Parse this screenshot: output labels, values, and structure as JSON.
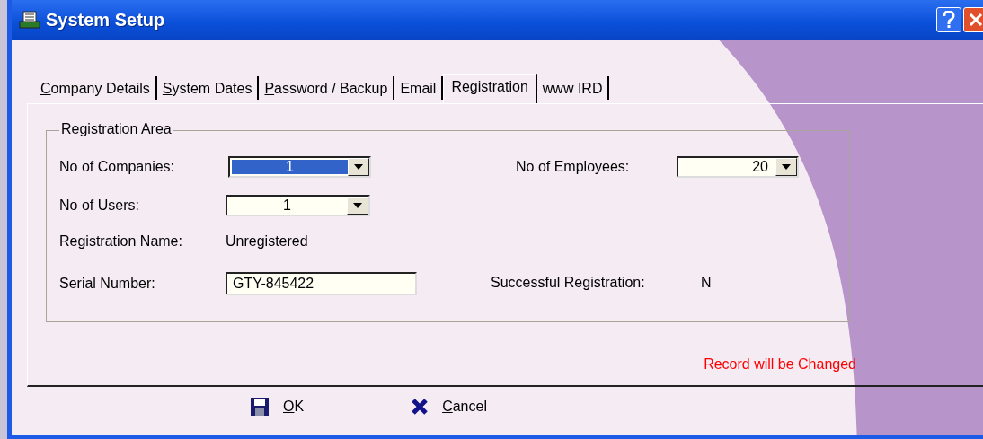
{
  "window": {
    "title": "System Setup"
  },
  "tabs": [
    {
      "label": "Company Details",
      "selected": false,
      "mnemonic": true
    },
    {
      "label": "System Dates",
      "selected": false,
      "mnemonic": true
    },
    {
      "label": "Password / Backup",
      "selected": false,
      "mnemonic": true
    },
    {
      "label": "Email",
      "selected": false,
      "mnemonic": false
    },
    {
      "label": "Registration",
      "selected": true,
      "mnemonic": false
    },
    {
      "label": "www IRD",
      "selected": false,
      "mnemonic": false
    }
  ],
  "group": {
    "title": "Registration Area",
    "companies": {
      "label": "No of Companies:",
      "value": "1",
      "selected": true
    },
    "users": {
      "label": "No of Users:",
      "value": "1",
      "selected": false
    },
    "employees": {
      "label": "No of Employees:",
      "value": "20",
      "selected": false
    },
    "registration_name": {
      "label": "Registration Name:",
      "value": "Unregistered"
    },
    "serial": {
      "label": "Serial Number:",
      "value": "GTY-845422"
    },
    "successful": {
      "label": "Successful Registration:",
      "value": "N"
    }
  },
  "status": "Record will be Changed",
  "buttons": [
    {
      "kind": "ok",
      "label": "OK",
      "mnemonic": true
    },
    {
      "kind": "cancel",
      "label": "Cancel",
      "mnemonic": true
    }
  ]
}
